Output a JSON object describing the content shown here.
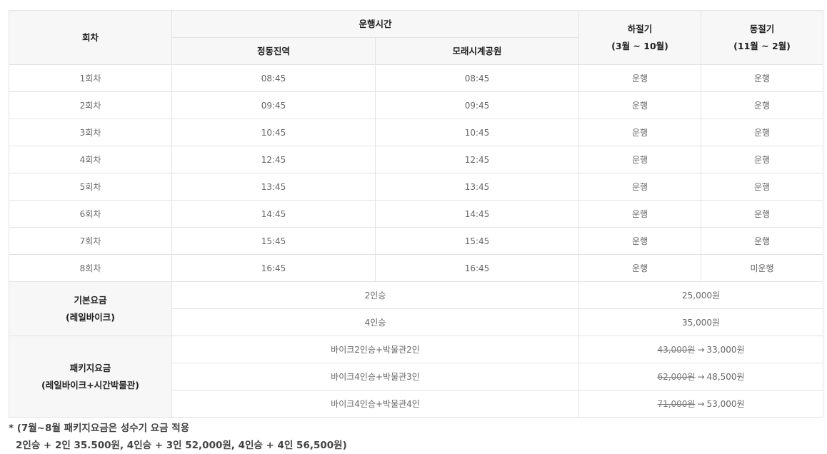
{
  "header": {
    "round": "회차",
    "operating_time": "운행시간",
    "station1": "정동진역",
    "station2": "모래시계공원",
    "summer": "하절기",
    "summer_range": "(3월 ~ 10월)",
    "winter": "동절기",
    "winter_range": "(11월 ~ 2월)"
  },
  "schedule": [
    {
      "round": "1회차",
      "t1": "08:45",
      "t2": "08:45",
      "summer": "운행",
      "winter": "운행"
    },
    {
      "round": "2회차",
      "t1": "09:45",
      "t2": "09:45",
      "summer": "운행",
      "winter": "운행"
    },
    {
      "round": "3회차",
      "t1": "10:45",
      "t2": "10:45",
      "summer": "운행",
      "winter": "운행"
    },
    {
      "round": "4회차",
      "t1": "12:45",
      "t2": "12:45",
      "summer": "운행",
      "winter": "운행"
    },
    {
      "round": "5회차",
      "t1": "13:45",
      "t2": "13:45",
      "summer": "운행",
      "winter": "운행"
    },
    {
      "round": "6회차",
      "t1": "14:45",
      "t2": "14:45",
      "summer": "운행",
      "winter": "운행"
    },
    {
      "round": "7회차",
      "t1": "15:45",
      "t2": "15:45",
      "summer": "운행",
      "winter": "운행"
    },
    {
      "round": "8회차",
      "t1": "16:45",
      "t2": "16:45",
      "summer": "운행",
      "winter": "미운행"
    }
  ],
  "basic_fare": {
    "label": "기본요금",
    "sublabel": "(레일바이크)",
    "rows": [
      {
        "type": "2인승",
        "price": "25,000원"
      },
      {
        "type": "4인승",
        "price": "35,000원"
      }
    ]
  },
  "package_fare": {
    "label": "패키지요금",
    "sublabel": "(레일바이크+시간박물관)",
    "arrow": "→",
    "rows": [
      {
        "type": "바이크2인승+박물관2인",
        "old": "43,000원",
        "new": "33,000원"
      },
      {
        "type": "바이크4인승+박물관3인",
        "old": "62,000원",
        "new": "48,500원"
      },
      {
        "type": "바이크4인승+박물관4인",
        "old": "71,000원",
        "new": "53,000원"
      }
    ]
  },
  "note": {
    "line1": "* (7월~8월 패키지요금은 성수기 요금 적용",
    "line2": "2인승 + 2인 35.500원, 4인승 + 3인 52,000원, 4인승 + 4인 56,500원)"
  }
}
